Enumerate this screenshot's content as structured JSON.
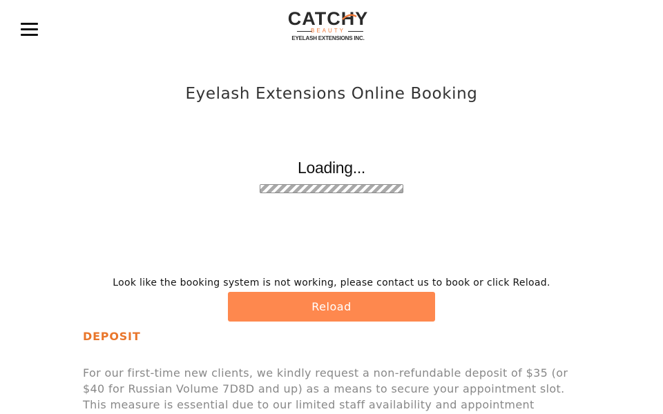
{
  "header": {
    "menu_icon": "hamburger-menu-icon",
    "logo": {
      "main": "CATCHY",
      "sub": "BEAUTY",
      "tagline": "EYELASH EXTENSIONS INC.",
      "accent_color": "#f07a3a"
    }
  },
  "main": {
    "title": "Eyelash Extensions Online Booking",
    "loading": {
      "text": "Loading...",
      "progress_fraction": 1.0
    },
    "notice": "Look like the booking system is not working, please contact us to book or click Reload.",
    "reload_label": "Reload",
    "reload_color": "#fe884e"
  },
  "deposit": {
    "heading": "DEPOSIT",
    "heading_color": "#e9762b",
    "text": "For our first-time new clients, we kindly request a non-refundable deposit of $35 (or $40 for Russian Volume 7D8D and up) as a means to secure your appointment slot. This measure is essential due to our limited staff availability and appointment"
  }
}
